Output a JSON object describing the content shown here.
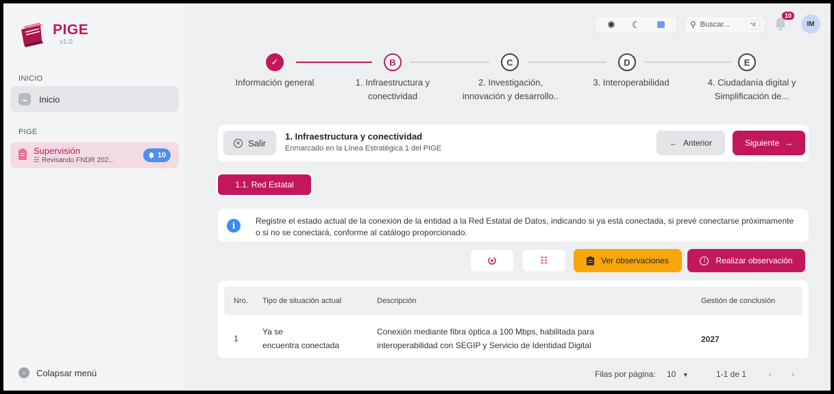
{
  "app": {
    "name": "PIGE",
    "version": "v1.0"
  },
  "sidebar": {
    "section_inicio": "INICIO",
    "home_label": "Inicio",
    "section_pige": "PIGE",
    "supervision_title": "Supervisión",
    "supervision_sub": "Revisando FNDR 202...",
    "supervision_badge": "10",
    "collapse_label": "Colapsar menú"
  },
  "header": {
    "search_placeholder": "Buscar...",
    "search_shortcut": "^K",
    "notifications_count": "10",
    "avatar_initials": "IM"
  },
  "stepper": {
    "steps": [
      {
        "marker": "✓",
        "label": "Información general",
        "state": "done"
      },
      {
        "marker": "B",
        "label": "1. Infraestructura y conectividad",
        "state": "active"
      },
      {
        "marker": "C",
        "label": "2. Investigación, innovación y desarrollo..",
        "state": "idle"
      },
      {
        "marker": "D",
        "label": "3. Interoperabilidad",
        "state": "idle"
      },
      {
        "marker": "E",
        "label": "4. Ciudadanía digital y Simplificación de...",
        "state": "idle"
      }
    ]
  },
  "section": {
    "exit_label": "Salir",
    "title": "1. Infraestructura y conectividad",
    "subtitle": "Enmarcado en la Línea Estratégica 1 del PIGE",
    "prev_label": "Anterior",
    "next_label": "Siguiente"
  },
  "subtab": {
    "label": "1.1. Red Estatal"
  },
  "info": {
    "text": "Registre el estado actual de la conexión de la entidad a la Red Estatal de Datos, indicando si ya está conectada, si prevé conectarse próximamente o si no se conectará, conforme al catálogo proporcionado."
  },
  "toolbar": {
    "view_obs_label": "Ver observaciones",
    "make_obs_label": "Realizar observación"
  },
  "table": {
    "headers": [
      "Nro.",
      "Tipo de situación actual",
      "Descripción",
      "Gestión de conclusión"
    ],
    "rows": [
      {
        "nro": "1",
        "tipo_line1": "Ya se",
        "tipo_line2": "encuentra conectada",
        "desc_line1": "Conexión mediante fibra óptica a 100 Mbps, habilitada para",
        "desc_line2": "interoperabilidad con SEGIP y Servicio de Identidad Digital",
        "gestion": "2027"
      }
    ]
  },
  "pagination": {
    "rows_per_page_label": "Filas por página:",
    "rows_per_page_value": "10",
    "range": "1-1 de 1"
  },
  "colors": {
    "primary": "#c2185b",
    "warning": "#f7a70b",
    "info": "#3c8cf0"
  }
}
